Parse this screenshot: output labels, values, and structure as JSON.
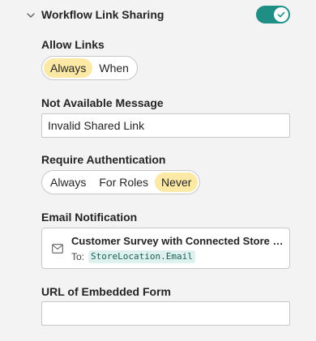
{
  "section": {
    "title": "Workflow Link Sharing",
    "expanded": true,
    "enabled": true,
    "icons": {
      "collapse": "chevron-down-icon",
      "toggle_check": "checkmark-icon"
    }
  },
  "allow_links": {
    "label": "Allow Links",
    "options": [
      "Always",
      "When"
    ],
    "selected": "Always"
  },
  "not_available_message": {
    "label": "Not Available Message",
    "value": "Invalid Shared Link"
  },
  "require_authentication": {
    "label": "Require Authentication",
    "options": [
      "Always",
      "For Roles",
      "Never"
    ],
    "selected": "Never"
  },
  "email_notification": {
    "label": "Email Notification",
    "icon": "mail-icon",
    "title": "Customer Survey with Connected Store Location",
    "to_label": "To:",
    "to_value": "StoreLocation.Email"
  },
  "embedded_form_url": {
    "label": "URL of Embedded Form",
    "value": ""
  },
  "colors": {
    "toggle_on": "#1f8f86",
    "selected_pill": "#fde9a6",
    "code_chip_bg": "#dff1ee",
    "border": "#c8c8c8"
  }
}
